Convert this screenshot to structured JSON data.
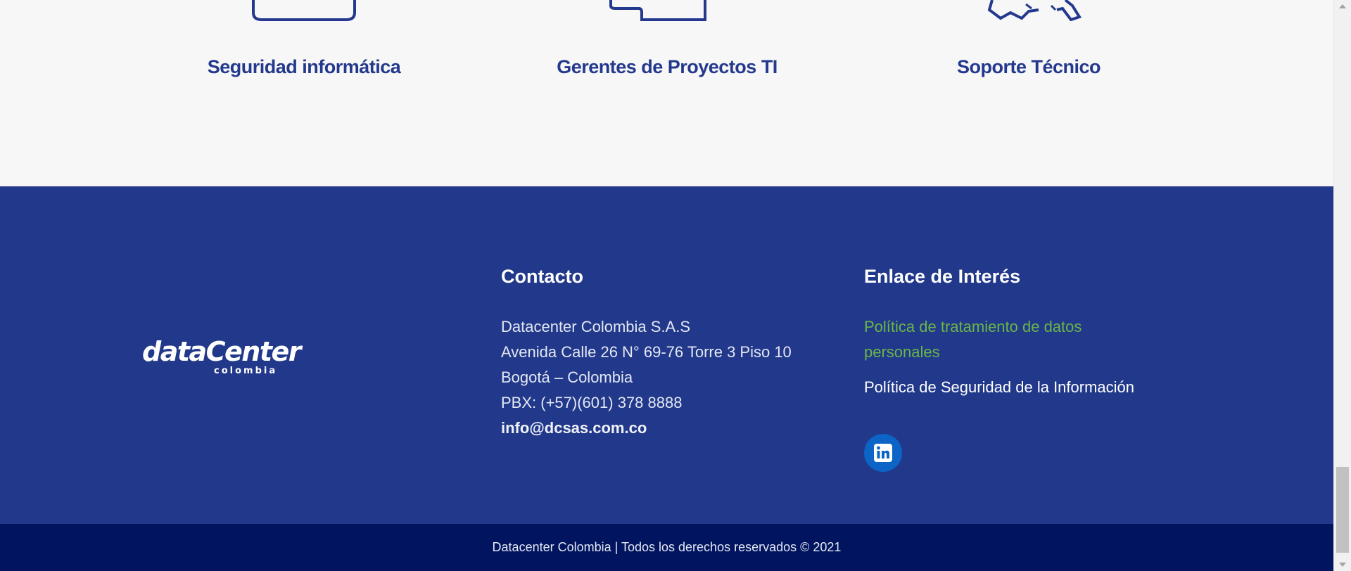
{
  "services": [
    {
      "title": "Seguridad informática",
      "icon": "monitor-icon"
    },
    {
      "title": "Gerentes de Proyectos TI",
      "icon": "puzzle-icon"
    },
    {
      "title": "Soporte Técnico",
      "icon": "tools-icon"
    }
  ],
  "footer": {
    "logo": {
      "main": "dataCenter",
      "sub": "colombia"
    },
    "contact": {
      "heading": "Contacto",
      "company": "Datacenter Colombia S.A.S",
      "address": "Avenida Calle 26 N° 69-76 Torre 3 Piso 10",
      "city": "Bogotá – Colombia",
      "phone": "PBX: (+57)(601) 378 8888",
      "email": "info@dcsas.com.co"
    },
    "links": {
      "heading": "Enlace de Interés",
      "privacy_policy": "Política de tratamiento de datos personales",
      "security_policy": "Política de Seguridad de la Información",
      "social_icon": "linkedin-icon"
    },
    "copyright": "Datacenter Colombia | Todos los derechos reservados © 2021"
  },
  "colors": {
    "brand_blue": "#24398d",
    "footer_bg": "#22398b",
    "bottom_bg": "#001460",
    "link_green": "#6ab547",
    "linkedin_blue": "#0b64c6"
  }
}
